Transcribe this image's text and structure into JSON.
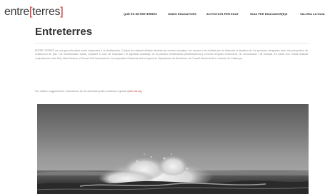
{
  "logo": {
    "part1": "entre",
    "part2": "[",
    "part3": "terres",
    "part4": "]"
  },
  "nav": {
    "items": [
      "QUÈ ÉS ENTRETERRES",
      "GUIES EDUCATIVES",
      "ACTIVITATS PER EDAT",
      "GUIA PER EDUCADOR(E)S",
      "VALORA LA GUIA"
    ]
  },
  "page": {
    "title": "Entreterres",
    "intro": "ENTRE TERRES és una guia educativa sobre migracions a la Mediterrània. Conjunt de material didàctic destinat als centres educatius, les escoles i els instituts per tal d'abordar la temàtica de les persones refugiades amb una perspectiva de construcció de pau i de transformació social, explicant el món de l'educació i el significat estratègic de la pràctica mediterrània (mediterraneous) a través d'espais d'intercanvi, de comunicació i de trobada. Es tracta d'un treball realitzat conjuntament entre Stop Mare Mortum, el Servei Civil Internacional i la cooperativa Edusenia amb el suport de l'Ajuntament de Barcelona i el Consell Nacional de la Joventut de Catalunya.",
    "contact_text": "Per dubtes, suggeriments i valoracions de les activitats podeu contactar a global @",
    "contact_link": "sci-cat.org"
  },
  "hero": {
    "description_icon": "sea-wave-photo"
  },
  "colors": {
    "accent": "#c8332e",
    "text": "#333333",
    "muted": "#8a8a8a"
  }
}
